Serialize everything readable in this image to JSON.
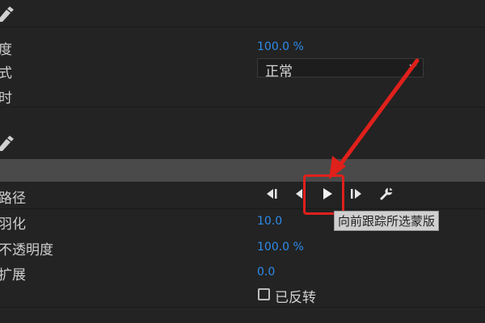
{
  "section1": {
    "pen_icon": "pen-icon",
    "rows": [
      {
        "label": "度",
        "value": "100.0 %"
      },
      {
        "label": "式"
      },
      {
        "label": "时"
      }
    ],
    "blend_mode": "正常"
  },
  "section2": {
    "pen_icon": "pen-icon",
    "rows": [
      {
        "label": "路径"
      },
      {
        "label": "羽化",
        "value": "10.0"
      },
      {
        "label": "不透明度",
        "value": "100.0 %"
      },
      {
        "label": "扩展",
        "value": "0.0"
      }
    ],
    "invert_label": "已反转",
    "invert_checked": false
  },
  "tracking_controls": {
    "icons": [
      "step-back-one-frame-icon",
      "track-backward-icon",
      "track-forward-icon",
      "step-forward-one-frame-icon",
      "wrench-icon"
    ]
  },
  "tooltip": "向前跟踪所选蒙版",
  "annotation": {
    "color": "#e0201b"
  },
  "colors": {
    "value_blue": "#2d8ceb",
    "background": "#232323",
    "section_bar": "#4a4a4a"
  }
}
